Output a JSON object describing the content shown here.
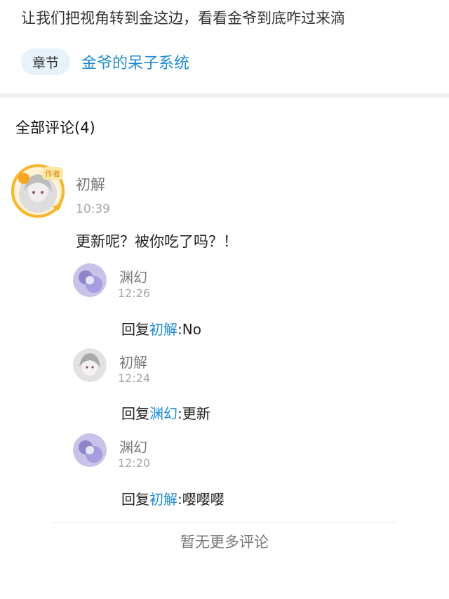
{
  "summary": "让我们把视角转到金这边，看看金爷到底咋过来滴",
  "chapter": {
    "tag_label": "章节",
    "title": "金爷的呆子系统"
  },
  "comments_header": "全部评论(4)",
  "main_comment": {
    "author": "初解",
    "badge": "作者",
    "time": "10:39",
    "text": "更新呢？被你吃了吗？！"
  },
  "replies": [
    {
      "author": "渊幻",
      "time": "12:26",
      "prefix": "回复",
      "mention": "初解",
      "sep": ":",
      "text": "No"
    },
    {
      "author": "初解",
      "time": "12:24",
      "prefix": "回复",
      "mention": "渊幻",
      "sep": ":",
      "text": "更新"
    },
    {
      "author": "渊幻",
      "time": "12:20",
      "prefix": "回复",
      "mention": "初解",
      "sep": ":",
      "text": "嘤嘤嘤"
    }
  ],
  "footer": "暂无更多评论",
  "colors": {
    "accent": "#1d8ad0",
    "tag_bg": "#e6f3fb",
    "author_ring": "#f5b731"
  }
}
